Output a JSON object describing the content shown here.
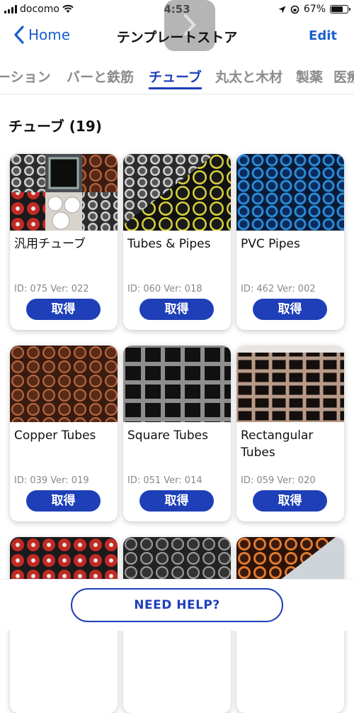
{
  "status_bar": {
    "carrier": "docomo",
    "time": "4:53",
    "battery": "67%"
  },
  "nav": {
    "back_label": "Home",
    "title": "テンプレートストア",
    "edit_label": "Edit"
  },
  "tabs": [
    "ーション",
    "バーと鉄筋",
    "チューブ",
    "丸太と木材",
    "製薬",
    "医療"
  ],
  "section": {
    "title": "チューブ (19)"
  },
  "cards": [
    {
      "name": "汎用チューブ",
      "meta": "ID: 075 Ver: 022",
      "button": "取得"
    },
    {
      "name": "Tubes & Pipes",
      "meta": "ID: 060 Ver: 018",
      "button": "取得"
    },
    {
      "name": "PVC Pipes",
      "meta": "ID: 462 Ver: 002",
      "button": "取得"
    },
    {
      "name": "Copper Tubes",
      "meta": "ID: 039 Ver: 019",
      "button": "取得"
    },
    {
      "name": "Square Tubes",
      "meta": "ID: 051 Ver: 014",
      "button": "取得"
    },
    {
      "name": "Rectangular Tubes",
      "meta": "ID: 059 Ver: 020",
      "button": "取得"
    }
  ],
  "help_button": "NEED HELP?",
  "colors": {
    "accent": "#1f3fb8",
    "link": "#1a5fd1"
  }
}
